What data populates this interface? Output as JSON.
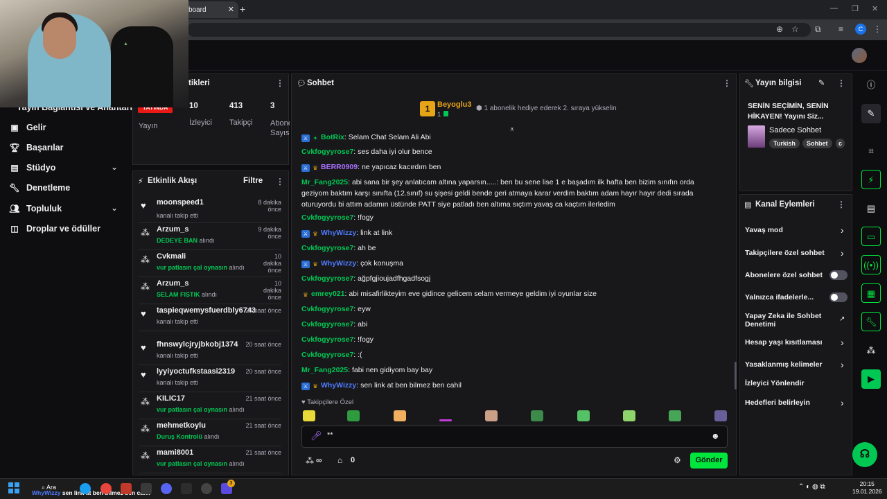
{
  "browser": {
    "tab_title": "board",
    "profile_letter": "C"
  },
  "sidebar": {
    "truncated_item": "Yayın Bağlantısı ve Anahtarı",
    "items": [
      {
        "label": "Gelir",
        "icon": "revenue-icon"
      },
      {
        "label": "Başarılar",
        "icon": "trophy-icon"
      },
      {
        "label": "Stüdyo",
        "icon": "studio-icon",
        "expandable": true
      },
      {
        "label": "Denetleme",
        "icon": "wrench-icon"
      },
      {
        "label": "Topluluk",
        "icon": "community-icon",
        "expandable": true
      },
      {
        "label": "Droplar ve ödüller",
        "icon": "drops-icon"
      }
    ]
  },
  "stats": {
    "title": "tikleri",
    "live_badge": "YAYINDA",
    "items": [
      {
        "value": "",
        "label": "Yayın"
      },
      {
        "value": "10",
        "label": "İzleyici"
      },
      {
        "value": "413",
        "label": "Takipçi"
      },
      {
        "value": "3",
        "label": "Abone Sayısı"
      }
    ]
  },
  "activity": {
    "title": "Etkinlik Akışı",
    "filter_label": "Filtre",
    "items": [
      {
        "name": "moonspeed1",
        "time": "8 dakika önce",
        "pre": "",
        "highlight": "",
        "post": "kanalı takip etti",
        "type": "follow"
      },
      {
        "name": "Arzum_s",
        "time": "9 dakika önce",
        "pre": "",
        "highlight": "DEDEYE BAN",
        "post": " alındı",
        "type": "reward"
      },
      {
        "name": "Cvkmali",
        "time": "10 dakika önce",
        "pre": "",
        "highlight": "vur patlasın çal oynasın",
        "post": " alındı",
        "type": "reward"
      },
      {
        "name": "Arzum_s",
        "time": "10 dakika önce",
        "pre": "",
        "highlight": "SELAM FISTIK",
        "post": " alındı",
        "type": "reward"
      },
      {
        "name": "taspieqwemysfuerdbly6743",
        "time": "20 saat önce",
        "pre": "",
        "highlight": "",
        "post": "kanalı takip etti",
        "type": "follow"
      },
      {
        "name": "fhnswylcjryjbkobj1374",
        "time": "20 saat önce",
        "pre": "",
        "highlight": "",
        "post": "kanalı takip etti",
        "type": "follow"
      },
      {
        "name": "lyyiyoctufkstaasi2319",
        "time": "20 saat önce",
        "pre": "",
        "highlight": "",
        "post": "kanalı takip etti",
        "type": "follow"
      },
      {
        "name": "KILIC17",
        "time": "21 saat önce",
        "pre": "",
        "highlight": "vur patlasın çal oynasın",
        "post": " alındı",
        "type": "reward"
      },
      {
        "name": "mehmetkoylu",
        "time": "21 saat önce",
        "pre": "",
        "highlight": "Duruş Kontrolü",
        "post": " alındı",
        "type": "reward"
      },
      {
        "name": "mami8001",
        "time": "21 saat önce",
        "pre": "",
        "highlight": "vur patlasın çal oynasın",
        "post": " alındı",
        "type": "reward"
      }
    ]
  },
  "chat": {
    "title": "Sohbet",
    "leader_name": "Beyoglu3",
    "leader_rank": "1",
    "leader_count": "1",
    "gift_prompt": "1 abonelik hediye ederek 2. sıraya yükselin",
    "messages": [
      {
        "badges": [
          "mod",
          "bot"
        ],
        "user": "BotRix",
        "color": "#00c853",
        "text": "Selam Chat Selam Ali Abi"
      },
      {
        "badges": [],
        "user": "Cvkfogyyrose7",
        "color": "#00c853",
        "text": "ses daha iyi olur bence"
      },
      {
        "badges": [
          "mod",
          "sub"
        ],
        "user": "BERR0909",
        "color": "#a970ff",
        "text": "ne yapıcaz kacırdım ben"
      },
      {
        "badges": [],
        "user": "Mr_Fang2025",
        "color": "#00c853",
        "text": "abi sana bir şey anlatıcam altına yaparsın.....: ben bu sene lise 1 e başadım ilk hafta ben bizim sınıfın orda geziyom baktım karşı sınıfta (12.sınıf) su şişesi geldi bende geri atmaya karar verdim baktım adam hayır hayır dedi sırada oturuyordu bi attım adamın üstünde PATT siye patladı ben altıma sıçtım yavaş ca kaçtım ilerledim"
      },
      {
        "badges": [],
        "user": "Cvkfogyyrose7",
        "color": "#00c853",
        "text": "!fogy"
      },
      {
        "badges": [
          "mod",
          "sub"
        ],
        "user": "WhyWizzy",
        "color": "#4f7bff",
        "text": "link at link"
      },
      {
        "badges": [],
        "user": "Cvkfogyyrose7",
        "color": "#00c853",
        "text": "ah be"
      },
      {
        "badges": [
          "mod",
          "sub"
        ],
        "user": "WhyWizzy",
        "color": "#4f7bff",
        "text": "çok konuşma"
      },
      {
        "badges": [],
        "user": "Cvkfogyyrose7",
        "color": "#00c853",
        "text": "ağpfgjioujadfhgadfsogj"
      },
      {
        "badges": [
          "sub"
        ],
        "user": "emrey021",
        "color": "#00c853",
        "text": "abi misafirlikteyim eve gidince gelicem selam vermeye geldim iyi oyunlar size"
      },
      {
        "badges": [],
        "user": "Cvkfogyyrose7",
        "color": "#00c853",
        "text": "eyw"
      },
      {
        "badges": [],
        "user": "Cvkfogyyrose7",
        "color": "#00c853",
        "text": "abi"
      },
      {
        "badges": [],
        "user": "Cvkfogyyrose7",
        "color": "#00c853",
        "text": "!fogy"
      },
      {
        "badges": [],
        "user": "Cvkfogyyrose7",
        "color": "#00c853",
        "text": ":("
      },
      {
        "badges": [],
        "user": "Mr_Fang2025",
        "color": "#00c853",
        "text": "fabi nen gidiyom bay bay"
      },
      {
        "badges": [
          "mod",
          "sub"
        ],
        "user": "WhyWizzy",
        "color": "#4f7bff",
        "text": "sen link at ben bilmez ben cahil"
      }
    ],
    "followers_only_label": "Takipçilere Özel",
    "input_value": "**",
    "points_value": "∞",
    "store_value": "0",
    "send_label": "Gönder"
  },
  "stream_info": {
    "title": "Yayın bilgisi",
    "stream_title": "SENİN SEÇİMİN, SENİN HİKAYEN! Yayını Siz...",
    "category": "Sadece Sohbet",
    "tags": [
      "Turkish",
      "Sohbet",
      "c"
    ]
  },
  "channel_actions": {
    "title": "Kanal Eylemleri",
    "items": [
      {
        "label": "Yavaş mod",
        "control": "chevron"
      },
      {
        "label": "Takipçilere özel sohbet",
        "control": "chevron"
      },
      {
        "label": "Abonelere özel sohbet",
        "control": "toggle"
      },
      {
        "label": "Yalnızca ifadelerle...",
        "control": "toggle"
      },
      {
        "label": "Yapay Zeka ile Sohbet Denetimi",
        "control": "external"
      },
      {
        "label": "Hesap yaşı kısıtlaması",
        "control": "chevron"
      },
      {
        "label": "Yasaklanmış kelimeler",
        "control": "chevron"
      },
      {
        "label": "İzleyici Yönlendir",
        "control": "none"
      },
      {
        "label": "Hedefleri belirleyin",
        "control": "chevron"
      }
    ]
  },
  "taskbar": {
    "search_label": "Ara",
    "notification_user": "WhyWizzy",
    "notification_text": "sen link at ben bilmez ben cahil",
    "time": "20:15",
    "date": "19.01.2026",
    "badge_count": "3"
  }
}
